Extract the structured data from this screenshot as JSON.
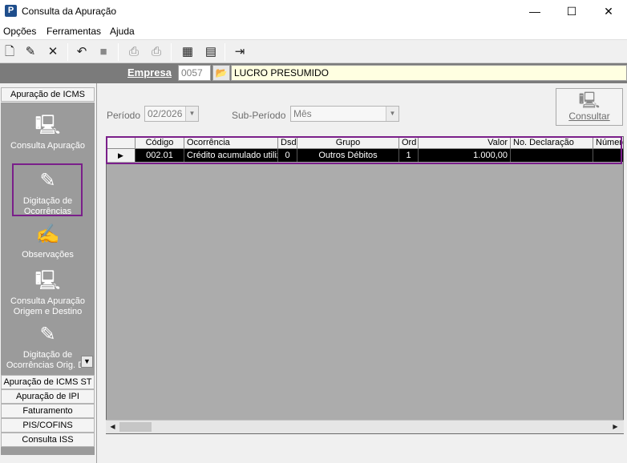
{
  "window": {
    "app_icon": "P",
    "title": "Consulta da Apuração",
    "minimize_icon": "—",
    "maximize_icon": "☐",
    "close_icon": "✕"
  },
  "menu": {
    "items": [
      "Opções",
      "Ferramentas",
      "Ajuda"
    ]
  },
  "toolbar": {
    "icons": [
      "new-document-icon",
      "edit-document-icon",
      "delete-icon",
      "undo-icon",
      "stop-icon",
      "print-icon",
      "print-preview-icon",
      "calculator-icon",
      "difal-icon",
      "exit-door-icon"
    ]
  },
  "empresa": {
    "label": "Empresa",
    "code": "0057",
    "lookup_icon": "📂",
    "name": "LUCRO PRESUMIDO"
  },
  "sidebar": {
    "sections": {
      "icms": "Apuração de ICMS",
      "icms_st": "Apuração de ICMS ST",
      "ipi": "Apuração de IPI",
      "faturamento": "Faturamento",
      "pis_cofins": "PIS/COFINS",
      "iss": "Consulta ISS"
    },
    "items": [
      {
        "icon": "🖳",
        "label": "Consulta Apuração"
      },
      {
        "icon": "✎",
        "label": "Digitação de Ocorrências"
      },
      {
        "icon": "✍",
        "label": "Observações"
      },
      {
        "icon": "🖳",
        "label": "Consulta Apuração Origem e Destino"
      },
      {
        "icon": "✎",
        "label": "Digitação de Ocorrências Orig. De"
      }
    ],
    "scroll_icon": "▼"
  },
  "form": {
    "periodo_label": "Período",
    "periodo_value": "02/2026",
    "subperiodo_label": "Sub-Período",
    "subperiodo_value": "Mês",
    "consultar_icon": "🖳",
    "consultar_label": "Consultar"
  },
  "grid": {
    "columns": [
      "Código",
      "Ocorrência",
      "Dsd",
      "Grupo",
      "Ord",
      "Valor",
      "No. Declaração",
      "Número"
    ],
    "rows": [
      {
        "indicator": "▶",
        "codigo": "002.01",
        "ocorrencia": "Crédito acumulado utiliz",
        "dsd": "0",
        "grupo": "Outros Débitos",
        "ord": "1",
        "valor": "1.000,00",
        "declaracao": "",
        "numero": ""
      }
    ],
    "scroll_left_icon": "◀",
    "scroll_right_icon": "▶"
  }
}
